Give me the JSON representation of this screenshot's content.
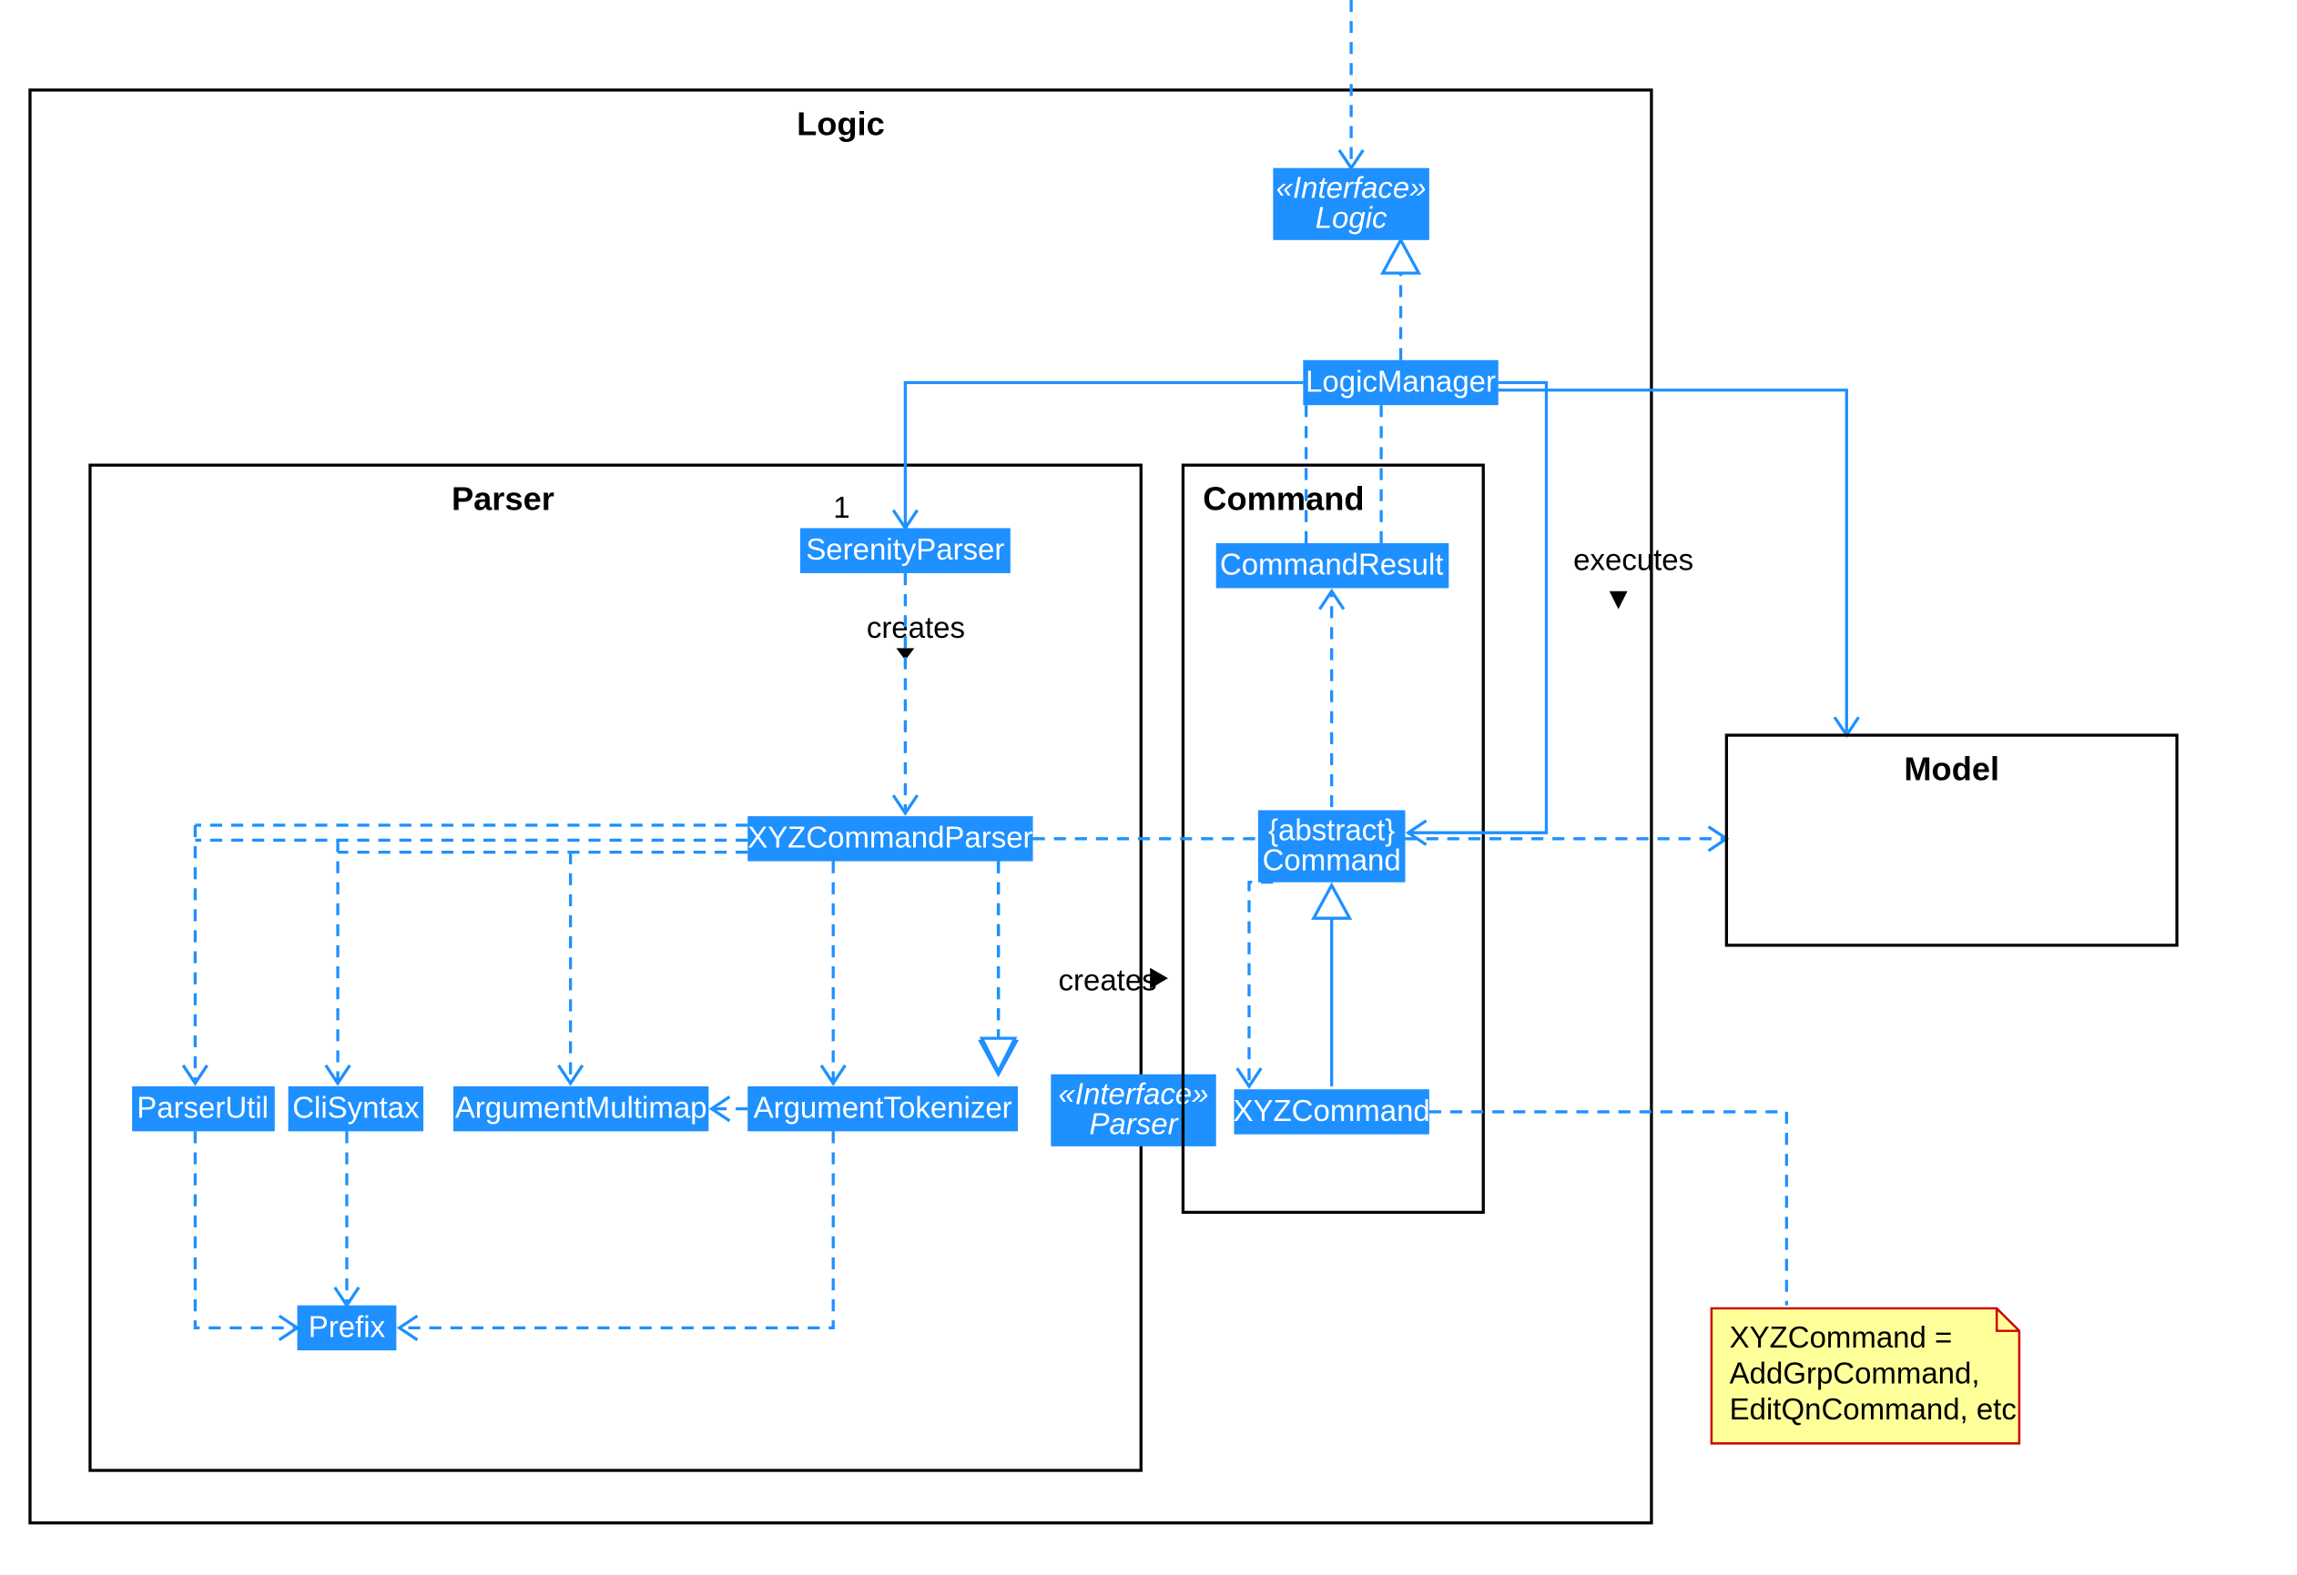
{
  "diagram": {
    "logic_frame": "Logic",
    "parser_frame": "Parser",
    "command_frame": "Command",
    "model_frame": "Model",
    "logic_interface_stereo": "«Interface»",
    "logic_interface_name": "Logic",
    "logic_manager": "LogicManager",
    "serenity_parser": "SerenityParser",
    "xyz_command_parser": "XYZCommandParser",
    "parser_util": "ParserUtil",
    "cli_syntax": "CliSyntax",
    "arg_multimap": "ArgumentMultimap",
    "arg_tokenizer": "ArgumentTokenizer",
    "parser_interface_stereo": "«Interface»",
    "parser_interface_name": "Parser",
    "prefix": "Prefix",
    "command_result": "CommandResult",
    "command_abs_stereo": "{abstract}",
    "command_abs_name": "Command",
    "xyz_command": "XYZCommand",
    "mult_one": "1",
    "creates1": "creates",
    "creates2": "creates",
    "executes": "executes",
    "note_line1": "XYZCommand =",
    "note_line2": "AddGrpCommand,",
    "note_line3": "EditQnCommand, etc"
  }
}
